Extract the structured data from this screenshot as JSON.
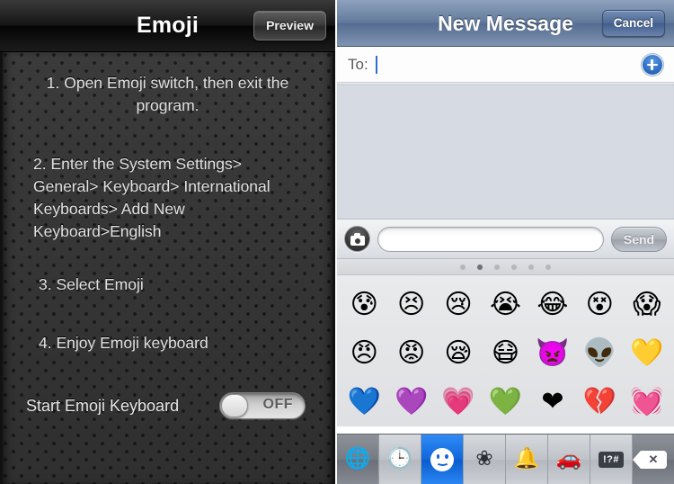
{
  "left_app": {
    "title": "Emoji",
    "preview_button": "Preview",
    "steps": [
      "1. Open Emoji switch, then exit the program.",
      "2. Enter the System Settings> General> Keyboard> International Keyboards> Add New Keyboard>English",
      "3. Select Emoji",
      "4. Enjoy Emoji keyboard"
    ],
    "toggle": {
      "label": "Start Emoji Keyboard",
      "state_text": "OFF",
      "enabled": false
    }
  },
  "right_app": {
    "title": "New Message",
    "cancel_button": "Cancel",
    "to_field": {
      "label": "To:",
      "value": "",
      "placeholder": ""
    },
    "add_contact_icon": "plus-circle-icon",
    "compose": {
      "camera_icon": "camera-icon",
      "input_value": "",
      "input_placeholder": "",
      "send_button": "Send"
    },
    "page_dots": {
      "count": 6,
      "active_index": 1
    },
    "emoji_rows": [
      [
        "😰",
        "😣",
        "😢",
        "😭",
        "😂",
        "😵",
        "😱"
      ],
      [
        "😠",
        "😡",
        "😪",
        "😷",
        "👿",
        "👽",
        "💛"
      ],
      [
        "💙",
        "💜",
        "💗",
        "💚",
        "❤",
        "💔",
        "💓"
      ]
    ],
    "keyboard_toolbar": [
      {
        "name": "globe-icon",
        "glyph": "🌐",
        "style": "dark",
        "active": false
      },
      {
        "name": "clock-icon",
        "glyph": "🕒",
        "style": "light",
        "active": false
      },
      {
        "name": "smiley-icon",
        "glyph": "",
        "style": "light",
        "active": true
      },
      {
        "name": "flower-icon",
        "glyph": "❀",
        "style": "light",
        "active": false
      },
      {
        "name": "bell-icon",
        "glyph": "🔔",
        "style": "light",
        "active": false
      },
      {
        "name": "car-icon",
        "glyph": "🚗",
        "style": "light",
        "active": false
      },
      {
        "name": "symbols-icon",
        "glyph": "!?#",
        "style": "light",
        "active": false
      },
      {
        "name": "delete-icon",
        "glyph": "✕",
        "style": "dark",
        "active": false
      }
    ]
  },
  "colors": {
    "emoji_titlebar": "#121212",
    "emoji_body": "#343434",
    "messages_titlebar": "#637b9d",
    "messages_accent": "#2f6ec4",
    "keyboard_active": "#1166dc",
    "message_area": "#d6dae3"
  }
}
